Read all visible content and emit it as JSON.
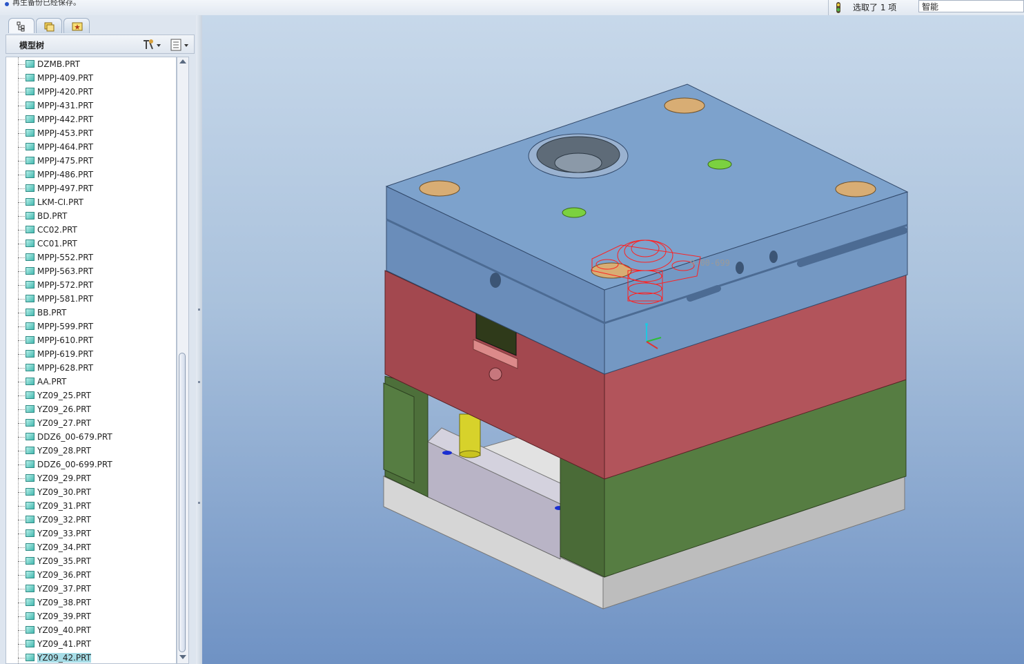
{
  "status": {
    "message": "再生备份已经保存。",
    "selection_label": "选取了 1 项",
    "filter_value": "智能"
  },
  "left_panel": {
    "tabs": [
      "model-tree-tab",
      "folder-browser-tab",
      "favorites-tab"
    ],
    "tree_title": "模型树",
    "tree_items": [
      "DZMB.PRT",
      "MPPJ-409.PRT",
      "MPPJ-420.PRT",
      "MPPJ-431.PRT",
      "MPPJ-442.PRT",
      "MPPJ-453.PRT",
      "MPPJ-464.PRT",
      "MPPJ-475.PRT",
      "MPPJ-486.PRT",
      "MPPJ-497.PRT",
      "LKM-CI.PRT",
      "BD.PRT",
      "CC02.PRT",
      "CC01.PRT",
      "MPPJ-552.PRT",
      "MPPJ-563.PRT",
      "MPPJ-572.PRT",
      "MPPJ-581.PRT",
      "BB.PRT",
      "MPPJ-599.PRT",
      "MPPJ-610.PRT",
      "MPPJ-619.PRT",
      "MPPJ-628.PRT",
      "AA.PRT",
      "YZ09_25.PRT",
      "YZ09_26.PRT",
      "YZ09_27.PRT",
      "DDZ6_00-679.PRT",
      "YZ09_28.PRT",
      "DDZ6_00-699.PRT",
      "YZ09_29.PRT",
      "YZ09_30.PRT",
      "YZ09_31.PRT",
      "YZ09_32.PRT",
      "YZ09_33.PRT",
      "YZ09_34.PRT",
      "YZ09_35.PRT",
      "YZ09_36.PRT",
      "YZ09_37.PRT",
      "YZ09_38.PRT",
      "YZ09_39.PRT",
      "YZ09_40.PRT",
      "YZ09_41.PRT",
      "YZ09_42.PRT"
    ],
    "selected_item": "YZ09_42.PRT"
  },
  "viewport": {
    "highlight_label": "9-00-699",
    "colors": {
      "top_plate": "#6f93bd",
      "cavity_plate": "#b2545b",
      "core_plate": "#557a40",
      "base_plate": "#cfcfcf",
      "highlight": "#ff2020"
    }
  }
}
